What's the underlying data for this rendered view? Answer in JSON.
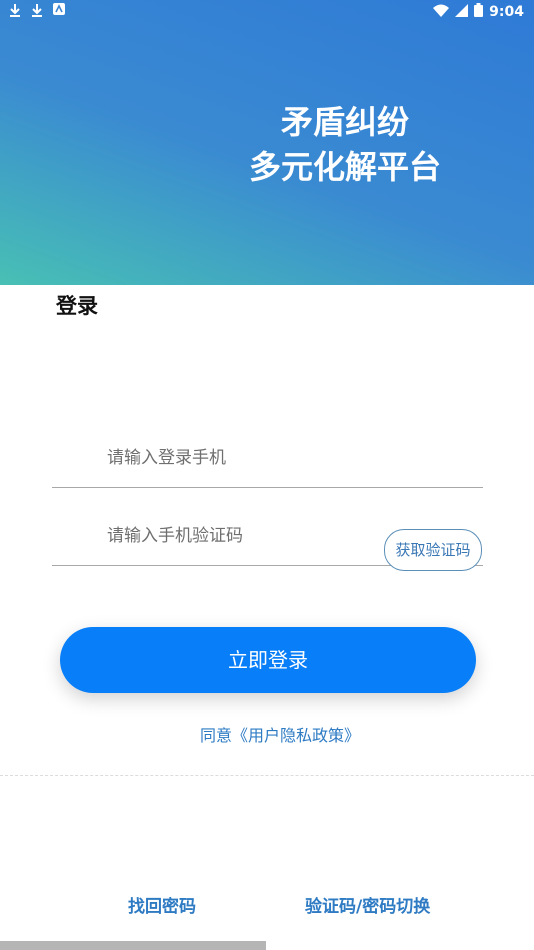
{
  "status_bar": {
    "time": "9:04",
    "left_icons": [
      "download-icon",
      "download-icon",
      "app-icon"
    ],
    "right_icons": [
      "wifi-icon",
      "signal-icon",
      "battery-icon"
    ]
  },
  "header": {
    "title_line1": "矛盾纠纷",
    "title_line2": "多元化解平台"
  },
  "login": {
    "title": "登录",
    "phone_placeholder": "请输入登录手机",
    "code_placeholder": "请输入手机验证码",
    "get_code_label": "获取验证码",
    "submit_label": "立即登录",
    "policy_text": "同意《用户隐私政策》"
  },
  "footer": {
    "find_password": "找回密码",
    "switch_mode": "验证码/密码切换"
  },
  "colors": {
    "primary": "#087ef8",
    "link": "#2e7bc4",
    "header_start": "#2e7ad6",
    "header_end": "#48c0b4"
  }
}
